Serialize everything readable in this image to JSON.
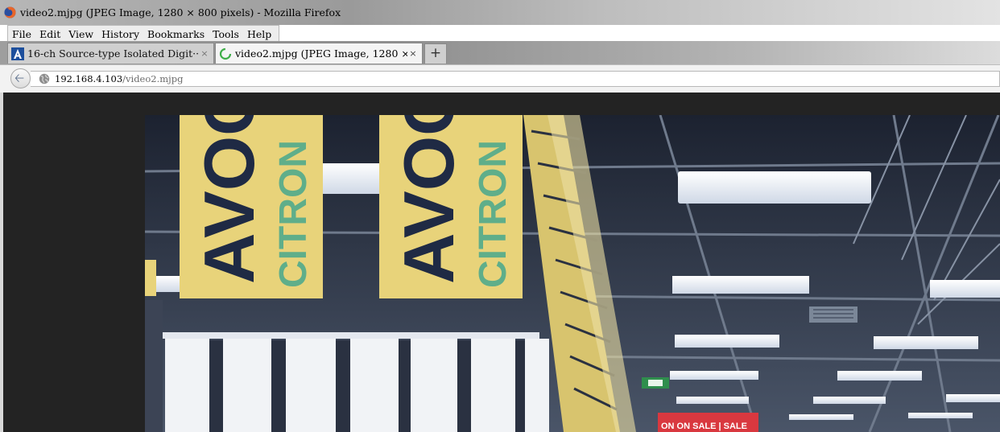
{
  "window": {
    "title": "video2.mjpg (JPEG Image, 1280 × 800 pixels) - Mozilla Firefox"
  },
  "menu": [
    {
      "label": "File"
    },
    {
      "label": "Edit"
    },
    {
      "label": "View"
    },
    {
      "label": "History"
    },
    {
      "label": "Bookmarks"
    },
    {
      "label": "Tools"
    },
    {
      "label": "Help"
    }
  ],
  "tabs": [
    {
      "label": "16-ch Source-type Isolated Digit···",
      "close": "×",
      "favicon": "advantech-a-icon",
      "active": false
    },
    {
      "label": "video2.mjpg (JPEG Image, 1280 ×···",
      "close": "×",
      "favicon": "loading-spinner-icon",
      "active": true
    }
  ],
  "new_tab": {
    "label": "+"
  },
  "navigation": {
    "back_icon": "back-arrow-icon",
    "url_host": "192.168.4.103",
    "url_path": "/video2.mjpg"
  },
  "image": {
    "banner_word_1": "AVOC",
    "banner_word_2": "CITRON",
    "sign_text": "ON  ON SALE | SALE",
    "colors": {
      "banner_yellow": "#e8d37a",
      "banner_navy": "#1f2a44",
      "banner_green": "#5fae8a",
      "sale_red": "#d9383f"
    }
  }
}
